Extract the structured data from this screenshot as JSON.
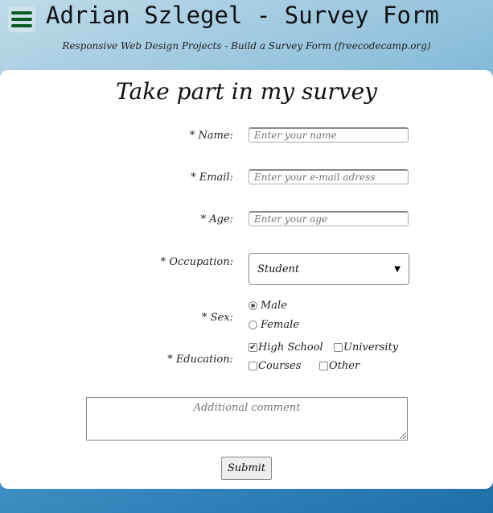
{
  "header": {
    "menu_icon": "hamburger-menu-icon",
    "title": "Adrian Szlegel - Survey Form",
    "subtitle": "Responsive Web Design Projects - Build a Survey Form (freecodecamp.org)"
  },
  "form": {
    "title": "Take part in my survey",
    "name": {
      "label": "* Name:",
      "placeholder": "Enter your name"
    },
    "email": {
      "label": "* Email:",
      "placeholder": "Enter your e-mail adress"
    },
    "age": {
      "label": "* Age:",
      "placeholder": "Enter your age"
    },
    "occupation": {
      "label": "* Occupation:",
      "value": "Student"
    },
    "sex": {
      "label": "* Sex:",
      "options": [
        "Male",
        "Female"
      ],
      "selected": "Male"
    },
    "education": {
      "label": "* Education:",
      "options": [
        "High School",
        "University",
        "Courses",
        "Other"
      ],
      "checked": [
        "High School"
      ]
    },
    "comment_placeholder": "Additional comment",
    "submit_label": "Submit"
  },
  "colors": {
    "accent": "#0b5a24",
    "background_top": "#bfdbe8",
    "background_bottom": "#1f6ea9"
  }
}
